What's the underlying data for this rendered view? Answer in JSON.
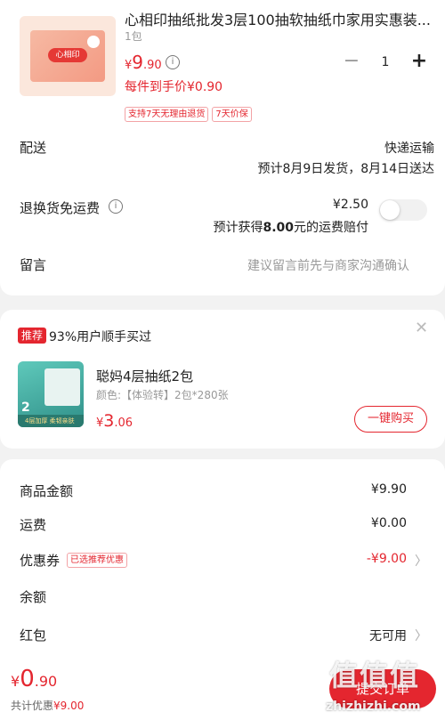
{
  "product": {
    "title": "心相印抽纸批发3层100抽软抽纸巾家用实惠装...",
    "spec": "1包",
    "logo_text": "心相印",
    "price_yen": "¥",
    "price_int": "9",
    "price_dec": ".90",
    "quantity": "1",
    "unit_price": "每件到手价¥0.90",
    "tags": [
      "支持7天无理由退货",
      "7天价保"
    ]
  },
  "delivery": {
    "label": "配送",
    "method": "快递运输",
    "estimate": "预计8月9日发货，8月14日送达"
  },
  "return_insurance": {
    "label": "退换货免运费",
    "price": "¥2.50",
    "desc_prefix": "预计获得",
    "desc_amount": "8.00",
    "desc_suffix": "元的运费赔付",
    "toggle_on": false
  },
  "message": {
    "label": "留言",
    "placeholder": "建议留言前先与商家沟通确认"
  },
  "recommendation": {
    "badge": "推荐",
    "title": "93%用户顺手买过",
    "name": "聪妈4层抽纸2包",
    "spec": "颜色:【体验转】2包*280张",
    "price_yen": "¥",
    "price_int": "3",
    "price_dec": ".06",
    "buy_label": "一键购买",
    "thumb_num": "2",
    "thumb_strip": "4层加厚 柔韧亲肤"
  },
  "summary": {
    "goods_label": "商品金额",
    "goods_value": "¥9.90",
    "shipping_label": "运费",
    "shipping_value": "¥0.00",
    "coupon_label": "优惠券",
    "coupon_tag": "已选推荐优惠",
    "coupon_value": "-¥9.00",
    "balance_label": "余额",
    "redpacket_label": "红包",
    "redpacket_value": "无可用"
  },
  "footer": {
    "total_yen": "¥",
    "total_int": "0",
    "total_dec": ".90",
    "discount_prefix": "共计优惠",
    "discount_value": "¥9.00",
    "submit_label": "提交订单",
    "watermark_logo": "值值值",
    "watermark_url": "zhizhizhi.com"
  },
  "colors": {
    "accent": "#e4262f",
    "background": "#f2f2f2"
  }
}
